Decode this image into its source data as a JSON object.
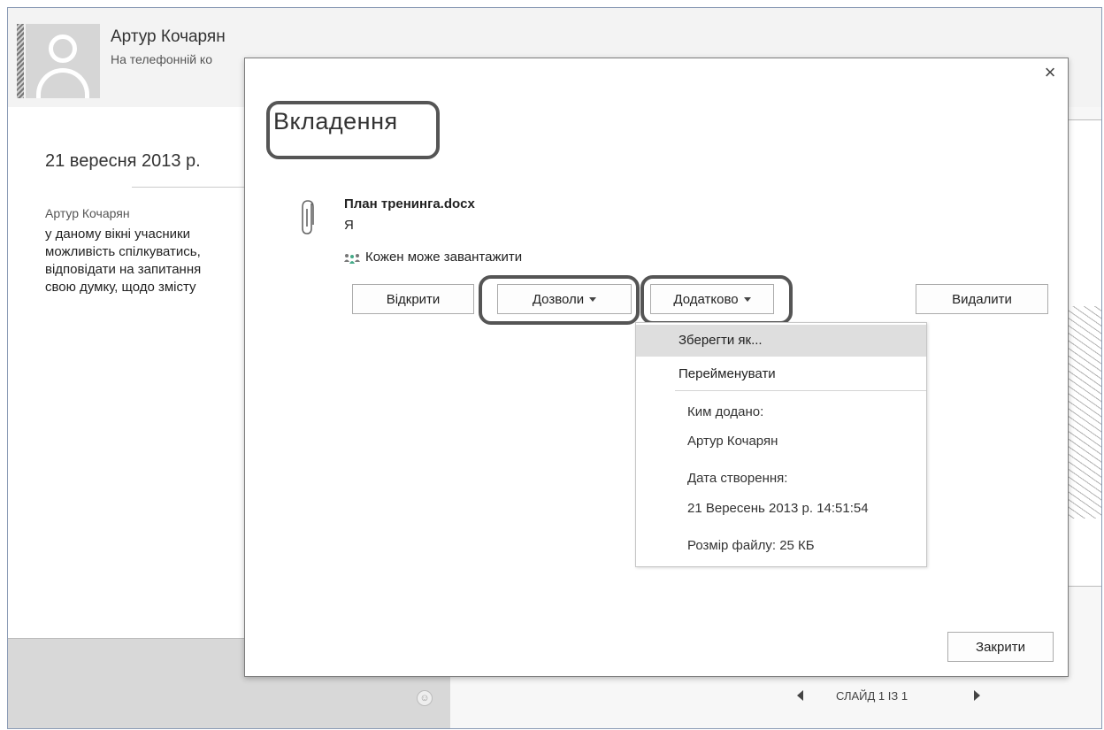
{
  "contact": {
    "name": "Артур Кочарян",
    "status": "На телефонній ко"
  },
  "chat": {
    "date": "21 вересня 2013 р.",
    "author": "Артур Кочарян",
    "message_lines": [
      "у даному вікні учасники",
      "можливість спілкуватись,",
      "відповідати на запитання",
      "свою думку, щодо змісту"
    ]
  },
  "slide_nav": {
    "counter": "СЛАЙД 1 ІЗ 1",
    "prev_icon": "triangle-left-icon",
    "next_icon": "triangle-right-icon"
  },
  "dialog": {
    "title": "Вкладення",
    "close_glyph": "×",
    "close_button": "Закрити",
    "attachment": {
      "file_name": "План тренинга.docx",
      "owner": "Я",
      "permission": "Кожен може завантажити",
      "icon": "paperclip-icon"
    },
    "buttons": {
      "open": "Відкрити",
      "permissions": "Дозволи",
      "more": "Додатково",
      "delete": "Видалити"
    },
    "more_menu": {
      "save_as": "Зберегти як...",
      "rename": "Перейменувати",
      "added_by_label": "Ким додано:",
      "added_by_value": "Артур Кочарян",
      "created_label": "Дата створення:",
      "created_value": "21 Вересень 2013 р. 14:51:54",
      "file_size": "Розмір файлу: 25 КБ"
    }
  },
  "colors": {
    "highlight_outline": "#555555",
    "menu_hover": "#dedede",
    "dialog_border": "#7d7d7d"
  }
}
